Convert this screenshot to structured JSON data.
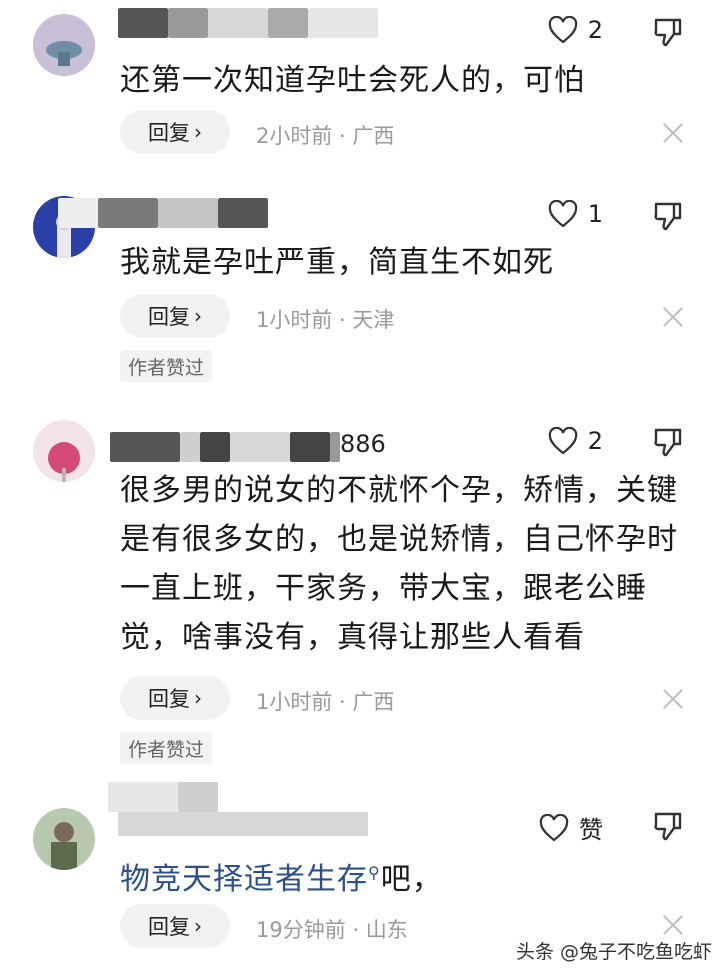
{
  "comments": [
    {
      "username_tail": "",
      "likes": "2",
      "text": "还第一次知道孕吐会死人的，可怕",
      "reply_label": "回复",
      "meta": "2小时前 · 广西",
      "author_liked": ""
    },
    {
      "username_tail": "",
      "likes": "1",
      "text": "我就是孕吐严重，简直生不如死",
      "reply_label": "回复",
      "meta": "1小时前 · 天津",
      "author_liked": "作者赞过"
    },
    {
      "username_tail": "886",
      "likes": "2",
      "text": "很多男的说女的不就怀个孕，矫情，关键是有很多女的，也是说矫情，自己怀孕时一直上班，干家务，带大宝，跟老公睡觉，啥事没有，真得让那些人看看",
      "reply_label": "回复",
      "meta": "1小时前 · 广西",
      "author_liked": "作者赞过"
    },
    {
      "username_tail": "",
      "likes": "赞",
      "text_link": "物竞天择适者生存",
      "text_rest": "吧，",
      "reply_label": "回复",
      "meta": "19分钟前 · 山东"
    }
  ],
  "watermark": "头条 @兔子不吃鱼吃虾",
  "colors": {
    "link": "#2a4f8c",
    "meta": "#9a9a9a",
    "button_bg": "#f2f2f2"
  }
}
